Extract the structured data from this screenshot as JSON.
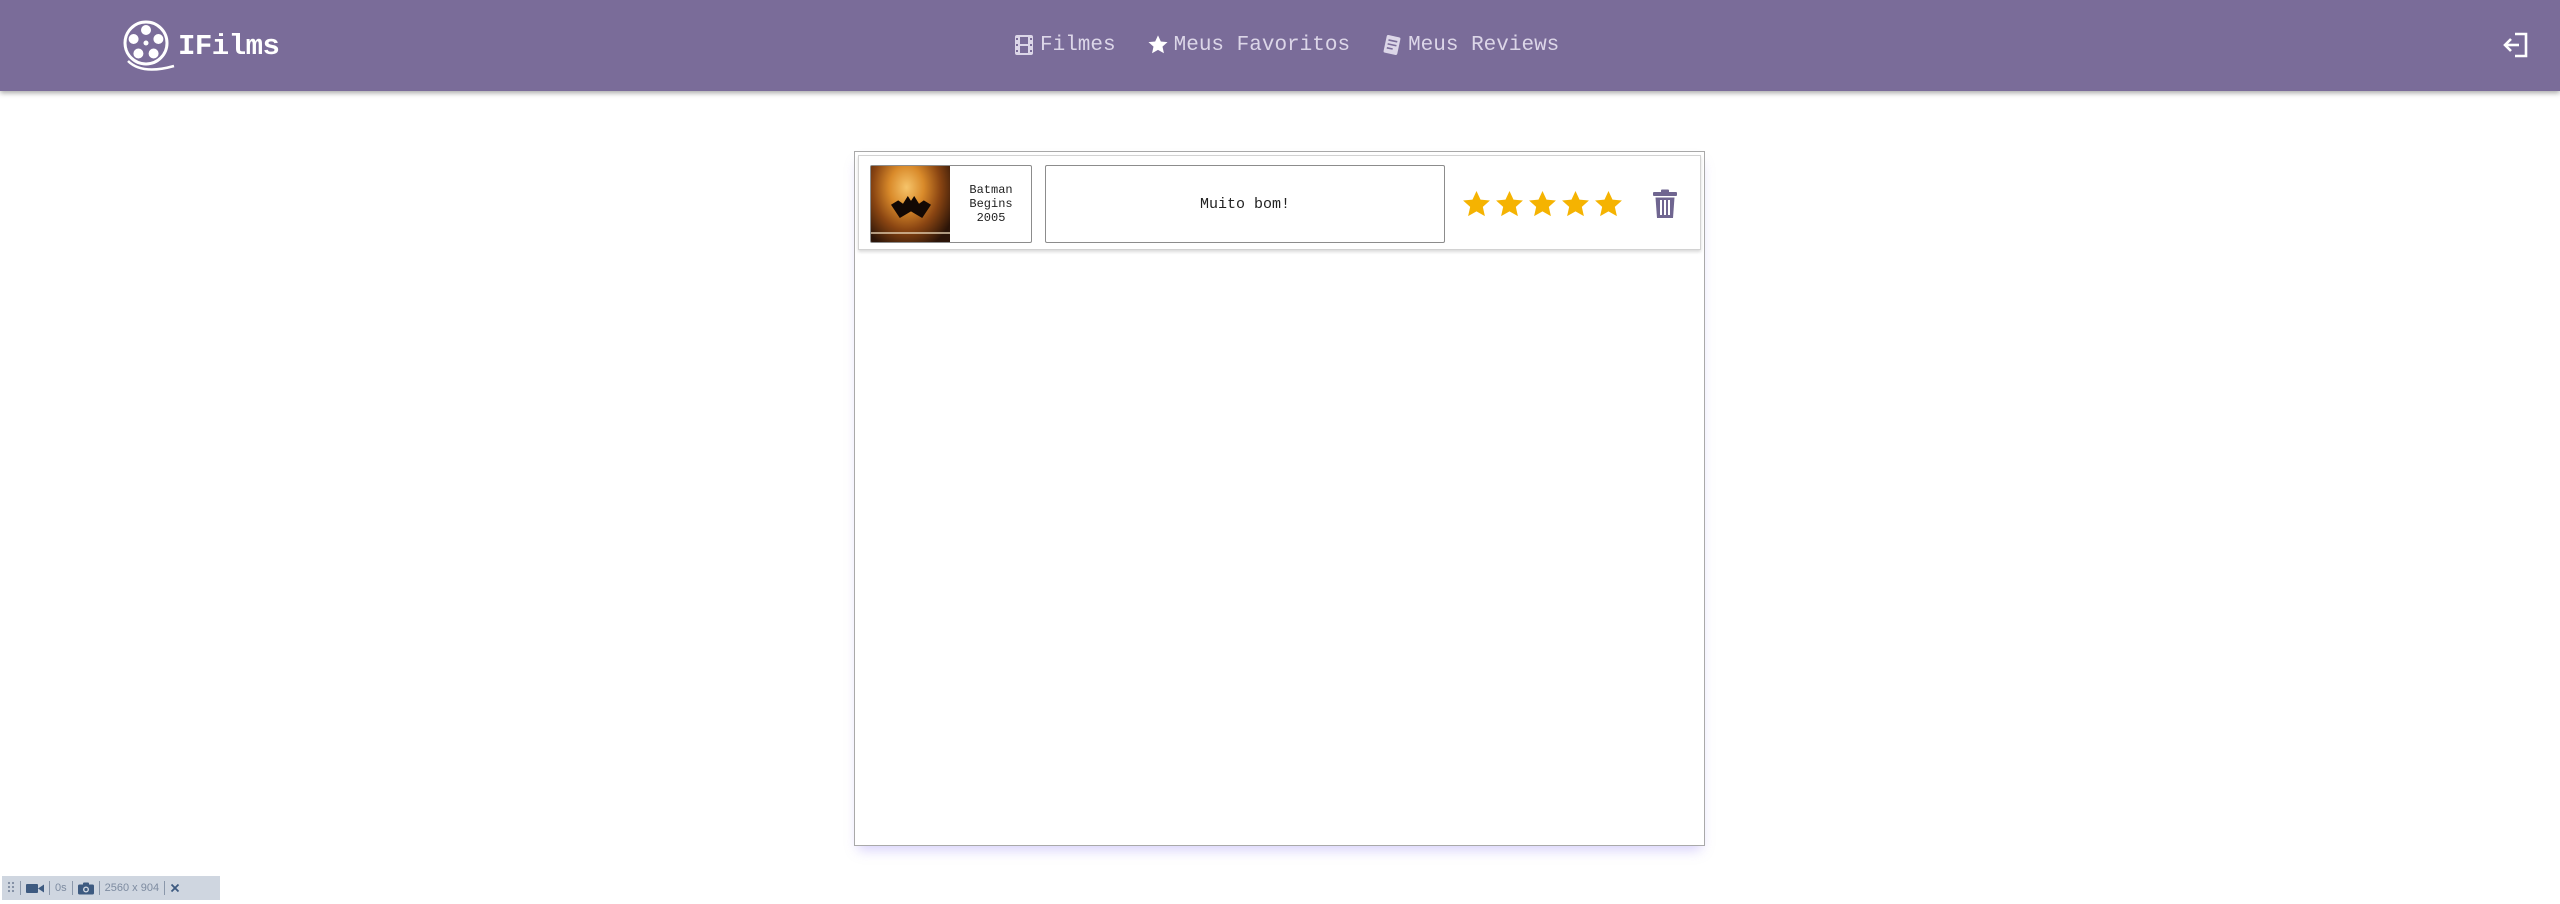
{
  "brand": {
    "name": "IFilms",
    "icon": "film-reel-icon"
  },
  "nav": {
    "items": [
      {
        "label": "Filmes",
        "icon": "film-icon"
      },
      {
        "label": "Meus Favoritos",
        "icon": "star-icon"
      },
      {
        "label": "Meus Reviews",
        "icon": "notes-icon"
      }
    ],
    "logout_icon": "logout-icon"
  },
  "reviews": [
    {
      "movie_title_line1": "Batman",
      "movie_title_line2": "Begins",
      "movie_year": "2005",
      "comment": "Muito bom!",
      "rating": 5,
      "rating_max": 5,
      "delete_icon": "trash-icon"
    }
  ],
  "toolbar": {
    "timer": "0s",
    "resolution": "2560 x 904",
    "icons": [
      "drag-handle-icon",
      "video-camera-icon",
      "camera-icon",
      "close-icon"
    ]
  },
  "colors": {
    "navbar": "#7a6c99",
    "nav_text": "#dcd6e8",
    "star": "#f5b301",
    "trash": "#6f6590"
  }
}
